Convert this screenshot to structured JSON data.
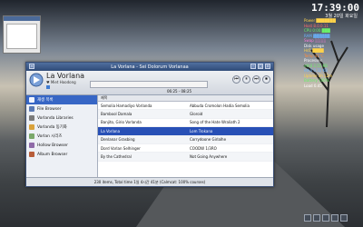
{
  "clock": {
    "time": "17:39:00",
    "date": "3월 20일 화요일"
  },
  "window": {
    "title": "La Vorlana - Sei Dolorum Vorlanaa",
    "program_name": "La Vorlana",
    "program_sub": "♥ Miet Hoodong",
    "stats_text": "",
    "time_text": "06:25 - 08:25",
    "controls": [
      "⏮",
      "⏸",
      "⏭",
      "⏹"
    ]
  },
  "sidebar": {
    "items": [
      {
        "label": "재생 목록",
        "icon_color": "#f0f4ff"
      },
      {
        "label": "File Browser",
        "icon_color": "#5a79b3"
      },
      {
        "label": "Vorlanda Libraries",
        "icon_color": "#7a7a7a"
      },
      {
        "label": "Vorlanda 동기화",
        "icon_color": "#d9a23b"
      },
      {
        "label": "Vorlan 시리즈",
        "icon_color": "#7aa86a"
      },
      {
        "label": "Hollow Browser",
        "icon_color": "#8f6aa8"
      },
      {
        "label": "Album Browser",
        "icon_color": "#b85d3a"
      }
    ]
  },
  "list": {
    "headers": [
      "제목",
      ""
    ],
    "rows": [
      [
        "Semolia Hamadiyo Vorlanda",
        "Abbuda Cromolon Hadia Semolia"
      ],
      [
        "Bambool Damala",
        "Gloroid"
      ],
      [
        "Banjito, Girio Vorlanda",
        "Song of the Hate Wraliath 2"
      ],
      [
        "La Vorlana",
        "Lom Trokana"
      ],
      [
        "Denlanar Grasbing",
        "Corrydoone Girlalhe"
      ],
      [
        "Dord Vorlan Selhinger",
        "COODW 1/3RO"
      ],
      [
        "By the Cathedral",
        "Not Going Anywhere"
      ]
    ]
  },
  "status_text": "230 items, Total time 1일 4시간 41분 (Calmcat: 100% courses)",
  "right_panel": {
    "lines": [
      "Power  ███████",
      "Host 8.0.0.11",
      "CPU 0:00 ███",
      "RAM ▓▓▓▓▓▓",
      "Swap ░░░░",
      "Disk usage",
      "Hd1  ████",
      "Temp 41°C",
      "Processes",
      "eth0 2.51 KB",
      "eth0 0.32 KB",
      "Uptime 3h 12m",
      "Battery 100%",
      "Load 0.45"
    ]
  }
}
